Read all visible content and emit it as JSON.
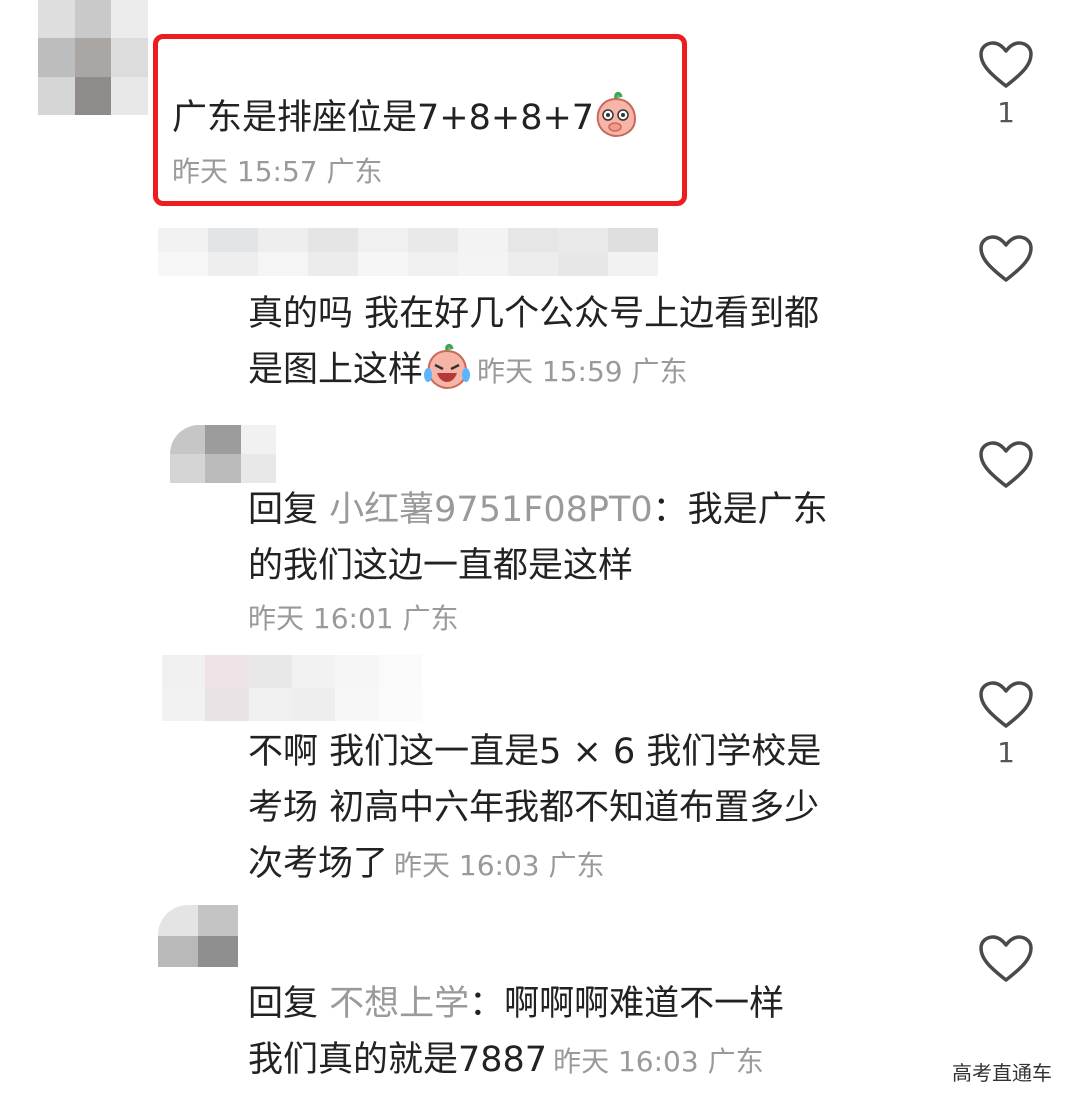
{
  "colors": {
    "highlight": "#ee1c1c",
    "meta": "#9a9a9a",
    "text": "#222222"
  },
  "comments": [
    {
      "text": "广东是排座位是7+8+8+7",
      "emoji": "peach-shy-emoji",
      "time": "昨天 15:57 广东",
      "likes": "1"
    },
    {
      "line1": "真的吗 我在好几个公众号上边看到都",
      "line2": "是图上这样",
      "emoji": "peach-cry-laugh-emoji",
      "time": "昨天 15:59 广东"
    },
    {
      "reply_prefix": "回复",
      "reply_target": "小红薯9751F08PT0",
      "line1_rest": "：我是广东",
      "line2": "的我们这边一直都是这样",
      "time": "昨天 16:01 广东"
    },
    {
      "line1": "不啊 我们这一直是5 × 6 我们学校是",
      "line2": "考场 初高中六年我都不知道布置多少",
      "line3": "次考场了",
      "time": "昨天 16:03 广东",
      "likes": "1"
    },
    {
      "reply_prefix": "回复",
      "reply_target": "不想上学",
      "line1_rest": "：啊啊啊难道不一样",
      "line2": "我们真的就是7887",
      "time": "昨天 16:03 广东"
    }
  ],
  "watermark": "高考直通车"
}
